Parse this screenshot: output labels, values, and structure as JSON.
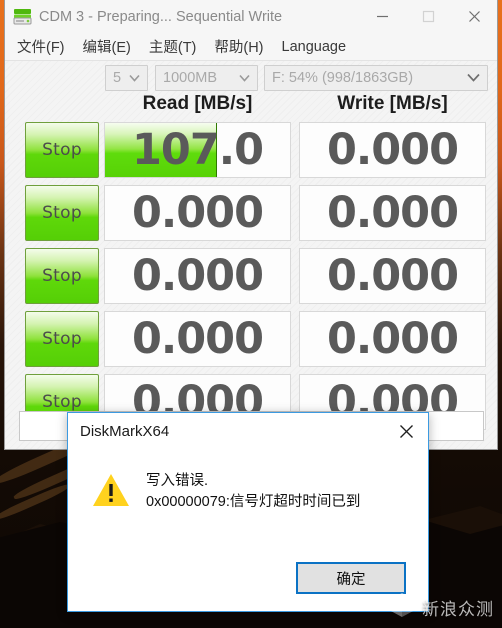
{
  "window": {
    "title": "CDM 3 - Preparing... Sequential Write",
    "icon": "disk-drive-icon",
    "buttons": {
      "minimize": "—",
      "maximize": "□",
      "close": "✕"
    }
  },
  "menu": {
    "items": [
      {
        "label": "文件(F)"
      },
      {
        "label": "编辑(E)"
      },
      {
        "label": "主题(T)"
      },
      {
        "label": "帮助(H)"
      },
      {
        "label": "Language"
      }
    ]
  },
  "controls": {
    "run_count": "5",
    "test_size": "1000MB",
    "drive": "F: 54% (998/1863GB)",
    "arrow": "⌄"
  },
  "columns": {
    "read": "Read [MB/s]",
    "write": "Write [MB/s]"
  },
  "rows": [
    {
      "button": "Stop",
      "read": "107.0",
      "read_progress_percent": 60,
      "write": "0.000",
      "write_progress_percent": 0
    },
    {
      "button": "Stop",
      "read": "0.000",
      "read_progress_percent": 0,
      "write": "0.000",
      "write_progress_percent": 0
    },
    {
      "button": "Stop",
      "read": "0.000",
      "read_progress_percent": 0,
      "write": "0.000",
      "write_progress_percent": 0
    },
    {
      "button": "Stop",
      "read": "0.000",
      "read_progress_percent": 0,
      "write": "0.000",
      "write_progress_percent": 0
    },
    {
      "button": "Stop",
      "read": "0.000",
      "read_progress_percent": 0,
      "write": "0.000",
      "write_progress_percent": 0
    }
  ],
  "status_box": {
    "value": "",
    "placeholder": ""
  },
  "dialog": {
    "title": "DiskMarkX64",
    "close": "✕",
    "icon": "warning-triangle-icon",
    "message_line1": "写入错误.",
    "message_line2": "0x00000079:信号灯超时时间已到",
    "ok_label": "确定"
  },
  "watermark": {
    "text": "新浪众测",
    "logo": "cube-logo"
  },
  "colors": {
    "accent_green": "#5fd80a",
    "stop_border": "#6f9f3c",
    "dialog_border": "#3b9ae1",
    "ok_focus": "#0b72c4",
    "warning_yellow": "#ffd21e",
    "wallpaper_orange": "#e8711d",
    "title_text": "#8a8a8a",
    "value_text": "#5a5a5a"
  }
}
